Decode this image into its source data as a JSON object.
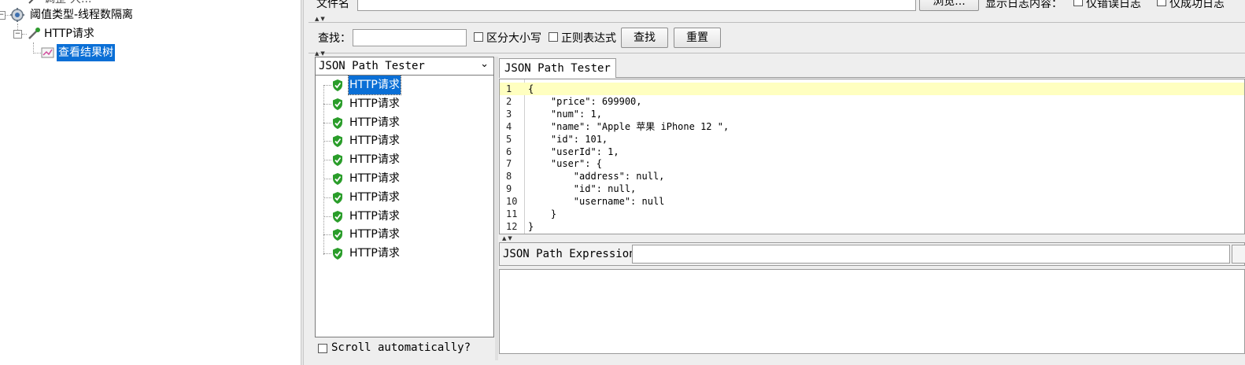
{
  "tree": {
    "partial_label": "调整-大...",
    "thread_group_label": "阈值类型-线程数隔离",
    "http_sampler_label": "HTTP请求",
    "listener_label": "查看结果树",
    "expander_minus": "−"
  },
  "file_row": {
    "filename_label": "文件名",
    "browse_label": "浏览...",
    "log_content_label": "显示日志内容：",
    "errors_only_label": "仅错误日志",
    "success_only_label": "仅成功日志"
  },
  "search_row": {
    "search_label": "查找：",
    "search_value": "",
    "case_sensitive_label": "区分大小写",
    "regex_label": "正则表达式",
    "find_button": "查找",
    "reset_button": "重置"
  },
  "renderer": {
    "selected": "JSON Path Tester",
    "arrow": "⌄"
  },
  "results": [
    {
      "label": "HTTP请求",
      "status": "success"
    },
    {
      "label": "HTTP请求",
      "status": "success"
    },
    {
      "label": "HTTP请求",
      "status": "success"
    },
    {
      "label": "HTTP请求",
      "status": "success"
    },
    {
      "label": "HTTP请求",
      "status": "success"
    },
    {
      "label": "HTTP请求",
      "status": "success"
    },
    {
      "label": "HTTP请求",
      "status": "success"
    },
    {
      "label": "HTTP请求",
      "status": "success"
    },
    {
      "label": "HTTP请求",
      "status": "success"
    },
    {
      "label": "HTTP请求",
      "status": "success"
    }
  ],
  "scroll_automatically_label": "Scroll automatically?",
  "tester": {
    "tab_label": "JSON Path Tester",
    "code_lines": [
      "{",
      "    \"price\": 699900,",
      "    \"num\": 1,",
      "    \"name\": \"Apple 苹果 iPhone 12 \",",
      "    \"id\": 101,",
      "    \"userId\": 1,",
      "    \"user\": {",
      "        \"address\": null,",
      "        \"id\": null,",
      "        \"username\": null",
      "    }",
      "}"
    ],
    "line_numbers": [
      "1",
      "2",
      "3",
      "4",
      "5",
      "6",
      "7",
      "8",
      "9",
      "10",
      "11",
      "12"
    ],
    "expression_label": "JSON Path Expression",
    "expression_value": ""
  },
  "colors": {
    "selection": "#0a6fd6",
    "success_shield": "#2a9d2a",
    "highlight_line": "#ffffc0"
  },
  "icons": {
    "thread_group": "gear-icon",
    "sampler": "pipette-icon",
    "listener": "chart-icon",
    "result_status": "shield-check-icon"
  }
}
